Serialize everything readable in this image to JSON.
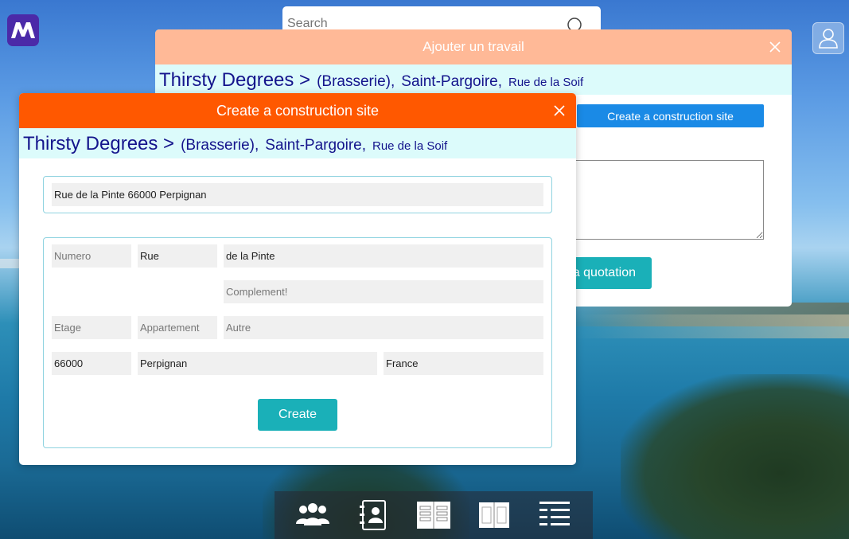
{
  "search": {
    "placeholder": "Search"
  },
  "back_dialog": {
    "title": "Ajouter un travail",
    "breadcrumb": {
      "name": "Thirsty Degrees >",
      "type": "(Brasserie),",
      "city": "Saint-Pargoire,",
      "street": "Rue de la Soif"
    },
    "create_site_label": "Create a construction site",
    "quotation_label": "a quotation"
  },
  "front_dialog": {
    "title": "Create a construction site",
    "breadcrumb": {
      "name": "Thirsty Degrees >",
      "type": "(Brasserie),",
      "city": "Saint-Pargoire,",
      "street": "Rue de la Soif"
    },
    "full_address": "Rue de la Pinte 66000 Perpignan",
    "fields": {
      "numero": {
        "value": "",
        "placeholder": "Numero"
      },
      "rue_type": {
        "value": "Rue",
        "placeholder": ""
      },
      "rue_name": {
        "value": "de la Pinte",
        "placeholder": ""
      },
      "complement": {
        "value": "",
        "placeholder": "Complement!"
      },
      "etage": {
        "value": "",
        "placeholder": "Etage"
      },
      "appartement": {
        "value": "",
        "placeholder": "Appartement"
      },
      "autre": {
        "value": "",
        "placeholder": "Autre"
      },
      "postal": {
        "value": "66000",
        "placeholder": ""
      },
      "city": {
        "value": "Perpignan",
        "placeholder": ""
      },
      "country": {
        "value": "France",
        "placeholder": ""
      }
    },
    "create_label": "Create"
  },
  "dock": {
    "items": [
      {
        "icon": "users-icon"
      },
      {
        "icon": "contacts-book-icon"
      },
      {
        "icon": "open-book-list-icon"
      },
      {
        "icon": "open-book-icon"
      },
      {
        "icon": "list-icon"
      }
    ]
  },
  "colors": {
    "front_header": "#ff5800",
    "back_header": "#ffb997",
    "breadcrumb_bg": "#dcfbfb",
    "breadcrumb_text": "#14148c",
    "teal_button": "#1ab0b8",
    "blue_button": "#1a8ae6"
  }
}
